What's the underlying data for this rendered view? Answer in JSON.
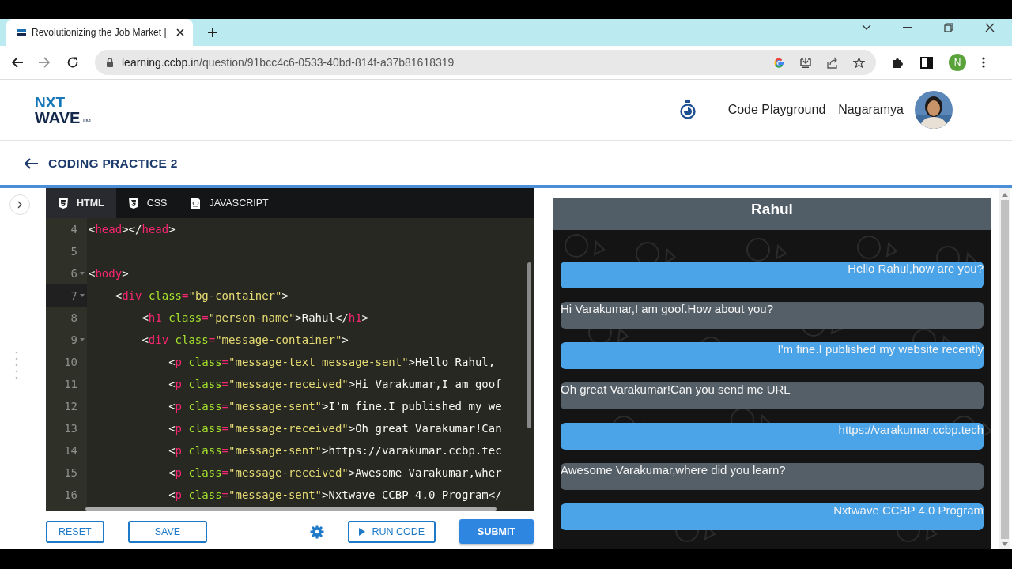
{
  "browser": {
    "tab_title": "Revolutionizing the Job Market |",
    "url_host": "learning.ccbp.in",
    "url_path": "/question/91bcc4c6-0533-40bd-814f-a37b81618319",
    "profile_initial": "N"
  },
  "header": {
    "logo": {
      "line1": "NXT",
      "line2": "WAVE",
      "mark": "TM"
    },
    "nav_link": "Code Playground",
    "user_name": "Nagaramya"
  },
  "page_title": "CODING PRACTICE 2",
  "editor": {
    "tabs": [
      {
        "label": "HTML",
        "kind": "html",
        "selected": true
      },
      {
        "label": "CSS",
        "kind": "css",
        "selected": false
      },
      {
        "label": "JAVASCRIPT",
        "kind": "js",
        "selected": false
      }
    ],
    "lines": [
      {
        "number": "4",
        "foldable": false,
        "active": false,
        "segments": [
          {
            "kind": "punct",
            "text": "<"
          },
          {
            "kind": "tag",
            "text": "head"
          },
          {
            "kind": "punct",
            "text": "></"
          },
          {
            "kind": "tag",
            "text": "head"
          },
          {
            "kind": "punct",
            "text": ">"
          }
        ]
      },
      {
        "number": "5",
        "foldable": false,
        "active": false
      },
      {
        "number": "6",
        "foldable": true,
        "active": false,
        "segments": [
          {
            "kind": "punct",
            "text": "<"
          },
          {
            "kind": "tag",
            "text": "body"
          },
          {
            "kind": "punct",
            "text": ">"
          }
        ]
      },
      {
        "number": "7",
        "foldable": true,
        "active": true,
        "segments": [
          {
            "kind": "punct",
            "text": "    <"
          },
          {
            "kind": "tag",
            "text": "div"
          },
          {
            "kind": "attr",
            "text": " class"
          },
          {
            "kind": "tag",
            "text": "="
          },
          {
            "kind": "string",
            "text": "\"bg-container\""
          },
          {
            "kind": "punct",
            "text": ">"
          }
        ]
      },
      {
        "number": "8",
        "foldable": false,
        "active": false,
        "segments": [
          {
            "kind": "punct",
            "text": "        <"
          },
          {
            "kind": "tag",
            "text": "h1"
          },
          {
            "kind": "attr",
            "text": " class"
          },
          {
            "kind": "tag",
            "text": "="
          },
          {
            "kind": "string",
            "text": "\"person-name\""
          },
          {
            "kind": "punct",
            "text": ">Rahul</"
          },
          {
            "kind": "tag",
            "text": "h1"
          },
          {
            "kind": "punct",
            "text": ">"
          }
        ]
      },
      {
        "number": "9",
        "foldable": true,
        "active": false,
        "segments": [
          {
            "kind": "punct",
            "text": "        <"
          },
          {
            "kind": "tag",
            "text": "div"
          },
          {
            "kind": "attr",
            "text": " class"
          },
          {
            "kind": "tag",
            "text": "="
          },
          {
            "kind": "string",
            "text": "\"message-container\""
          },
          {
            "kind": "punct",
            "text": ">"
          }
        ]
      },
      {
        "number": "10",
        "foldable": false,
        "active": false,
        "segments": [
          {
            "kind": "punct",
            "text": "            <"
          },
          {
            "kind": "tag",
            "text": "p"
          },
          {
            "kind": "attr",
            "text": " class"
          },
          {
            "kind": "tag",
            "text": "="
          },
          {
            "kind": "string",
            "text": "\"message-text message-sent\""
          },
          {
            "kind": "punct",
            "text": ">Hello Rahul,"
          }
        ]
      },
      {
        "number": "11",
        "foldable": false,
        "active": false,
        "segments": [
          {
            "kind": "punct",
            "text": "            <"
          },
          {
            "kind": "tag",
            "text": "p"
          },
          {
            "kind": "attr",
            "text": " class"
          },
          {
            "kind": "tag",
            "text": "="
          },
          {
            "kind": "string",
            "text": "\"message-received\""
          },
          {
            "kind": "punct",
            "text": ">Hi Varakumar,I am goof"
          }
        ]
      },
      {
        "number": "12",
        "foldable": false,
        "active": false,
        "segments": [
          {
            "kind": "punct",
            "text": "            <"
          },
          {
            "kind": "tag",
            "text": "p"
          },
          {
            "kind": "attr",
            "text": " class"
          },
          {
            "kind": "tag",
            "text": "="
          },
          {
            "kind": "string",
            "text": "\"message-sent\""
          },
          {
            "kind": "punct",
            "text": ">I'm fine.I published my we"
          }
        ]
      },
      {
        "number": "13",
        "foldable": false,
        "active": false,
        "segments": [
          {
            "kind": "punct",
            "text": "            <"
          },
          {
            "kind": "tag",
            "text": "p"
          },
          {
            "kind": "attr",
            "text": " class"
          },
          {
            "kind": "tag",
            "text": "="
          },
          {
            "kind": "string",
            "text": "\"message-received\""
          },
          {
            "kind": "punct",
            "text": ">Oh great Varakumar!Can"
          }
        ]
      },
      {
        "number": "14",
        "foldable": false,
        "active": false,
        "segments": [
          {
            "kind": "punct",
            "text": "            <"
          },
          {
            "kind": "tag",
            "text": "p"
          },
          {
            "kind": "attr",
            "text": " class"
          },
          {
            "kind": "tag",
            "text": "="
          },
          {
            "kind": "string",
            "text": "\"message-sent\""
          },
          {
            "kind": "punct",
            "text": ">https://varakumar.ccbp.tec"
          }
        ]
      },
      {
        "number": "15",
        "foldable": false,
        "active": false,
        "segments": [
          {
            "kind": "punct",
            "text": "            <"
          },
          {
            "kind": "tag",
            "text": "p"
          },
          {
            "kind": "attr",
            "text": " class"
          },
          {
            "kind": "tag",
            "text": "="
          },
          {
            "kind": "string",
            "text": "\"message-received\""
          },
          {
            "kind": "punct",
            "text": ">Awesome Varakumar,wher"
          }
        ]
      },
      {
        "number": "16",
        "foldable": false,
        "active": false,
        "segments": [
          {
            "kind": "punct",
            "text": "            <"
          },
          {
            "kind": "tag",
            "text": "p"
          },
          {
            "kind": "attr",
            "text": " class"
          },
          {
            "kind": "tag",
            "text": "="
          },
          {
            "kind": "string",
            "text": "\"message-sent\""
          },
          {
            "kind": "punct",
            "text": ">Nxtwave CCBP 4.0 Program</"
          }
        ]
      }
    ]
  },
  "actions": {
    "reset": "RESET",
    "save": "SAVE",
    "run": "RUN CODE",
    "submit": "SUBMIT"
  },
  "preview": {
    "heading": "Rahul",
    "messages": [
      {
        "kind": "sent",
        "text": "Hello Rahul,how are you?"
      },
      {
        "kind": "received",
        "text": "Hi Varakumar,I am goof.How about you?"
      },
      {
        "kind": "sent",
        "text": "I'm fine.I published my website recently"
      },
      {
        "kind": "received",
        "text": "Oh great Varakumar!Can you send me URL"
      },
      {
        "kind": "sent",
        "text": "https://varakumar.ccbp.tech"
      },
      {
        "kind": "received",
        "text": "Awesome Varakumar,where did you learn?"
      },
      {
        "kind": "sent",
        "text": "Nxtwave CCBP 4.0 Program"
      }
    ]
  }
}
